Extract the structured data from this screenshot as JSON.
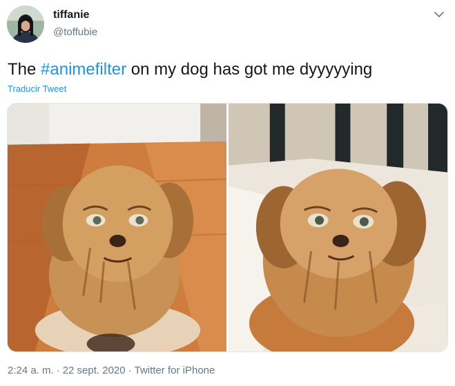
{
  "tweet": {
    "author": {
      "name": "tiffanie",
      "handle": "@toffubie"
    },
    "text_before": "The ",
    "hashtag": "#animefilter",
    "text_after": " on my dog has got me dyyyyying",
    "translate_label": "Traducir Tweet",
    "time": "2:24 a. m.",
    "separator": "·",
    "date": "22 sept. 2020",
    "source": "Twitter for iPhone",
    "icons": {
      "more": "chevron-down-icon"
    },
    "colors": {
      "link": "#1b95e0",
      "secondary_text": "#657786",
      "primary_text": "#14171a"
    }
  }
}
